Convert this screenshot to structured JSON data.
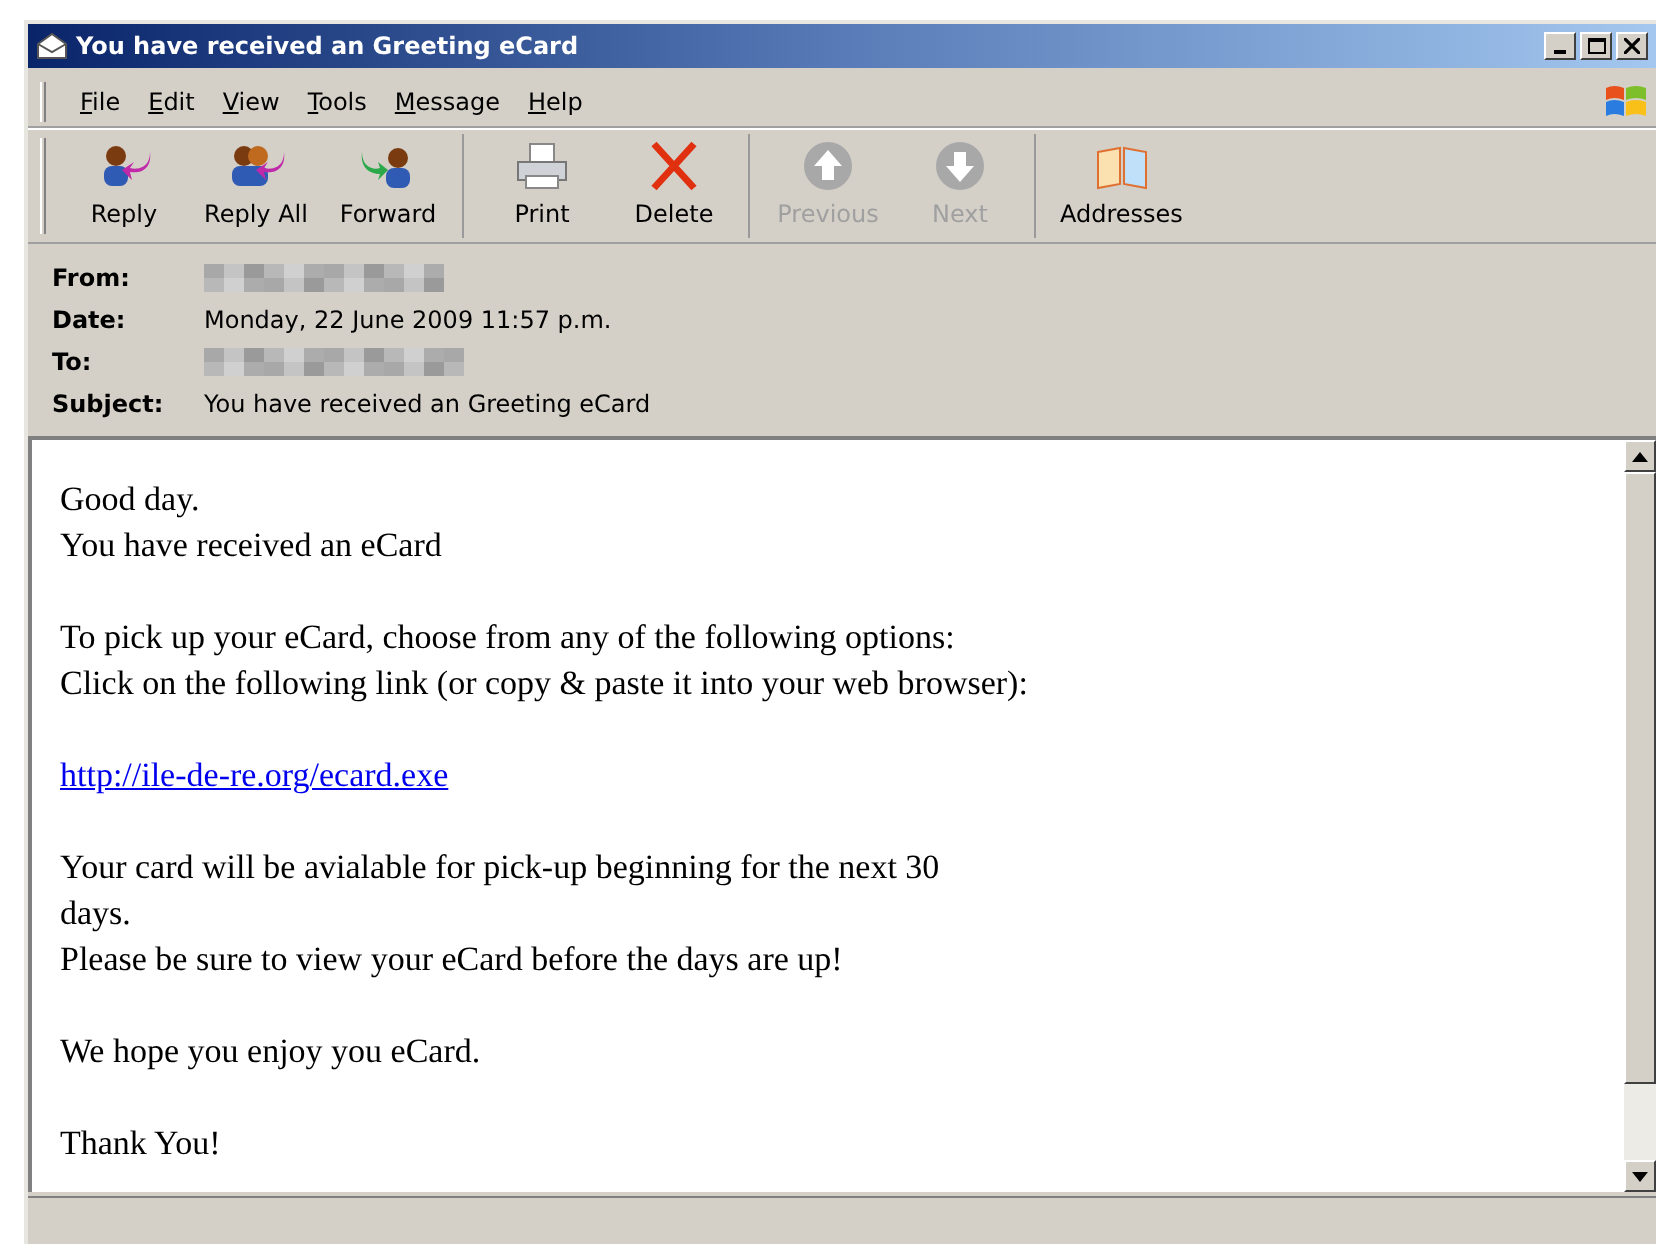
{
  "window": {
    "title": "You have received an Greeting eCard"
  },
  "menu": [
    {
      "label": "File"
    },
    {
      "label": "Edit"
    },
    {
      "label": "View"
    },
    {
      "label": "Tools"
    },
    {
      "label": "Message"
    },
    {
      "label": "Help"
    }
  ],
  "toolbar": [
    {
      "buttons": [
        {
          "kind": "reply",
          "label": "Reply",
          "disabled": false
        },
        {
          "kind": "replyall",
          "label": "Reply All",
          "disabled": false
        },
        {
          "kind": "forward",
          "label": "Forward",
          "disabled": false
        }
      ]
    },
    {
      "buttons": [
        {
          "kind": "print",
          "label": "Print",
          "disabled": false
        },
        {
          "kind": "delete",
          "label": "Delete",
          "disabled": false
        }
      ]
    },
    {
      "buttons": [
        {
          "kind": "previous",
          "label": "Previous",
          "disabled": true
        },
        {
          "kind": "next",
          "label": "Next",
          "disabled": true
        }
      ]
    },
    {
      "buttons": [
        {
          "kind": "addresses",
          "label": "Addresses",
          "disabled": false
        }
      ]
    }
  ],
  "header": [
    {
      "label": "From:",
      "kind": "redacted"
    },
    {
      "label": "Date:",
      "kind": "text",
      "value": "Monday, 22 June 2009 11:57 p.m."
    },
    {
      "label": "To:",
      "kind": "redacted"
    },
    {
      "label": "Subject:",
      "kind": "text",
      "value": "You have received an Greeting eCard"
    }
  ],
  "body": [
    {
      "kind": "text",
      "text": "Good day."
    },
    {
      "kind": "text",
      "text": "You have received an eCard"
    },
    {
      "kind": "gap"
    },
    {
      "kind": "text",
      "text": "To pick up your eCard, choose from any of the following options:"
    },
    {
      "kind": "text",
      "text": "Click on the following link (or copy & paste it into your web browser):"
    },
    {
      "kind": "gap"
    },
    {
      "kind": "link",
      "text": "http://ile-de-re.org/ecard.exe"
    },
    {
      "kind": "gap"
    },
    {
      "kind": "text",
      "text": "Your card will be avialable for pick-up beginning for the next 30"
    },
    {
      "kind": "text",
      "text": "days."
    },
    {
      "kind": "text",
      "text": "Please be sure to view your eCard before the days are up!"
    },
    {
      "kind": "gap"
    },
    {
      "kind": "text",
      "text": "We hope you enjoy you eCard."
    },
    {
      "kind": "gap"
    },
    {
      "kind": "text",
      "text": "Thank You!"
    }
  ]
}
